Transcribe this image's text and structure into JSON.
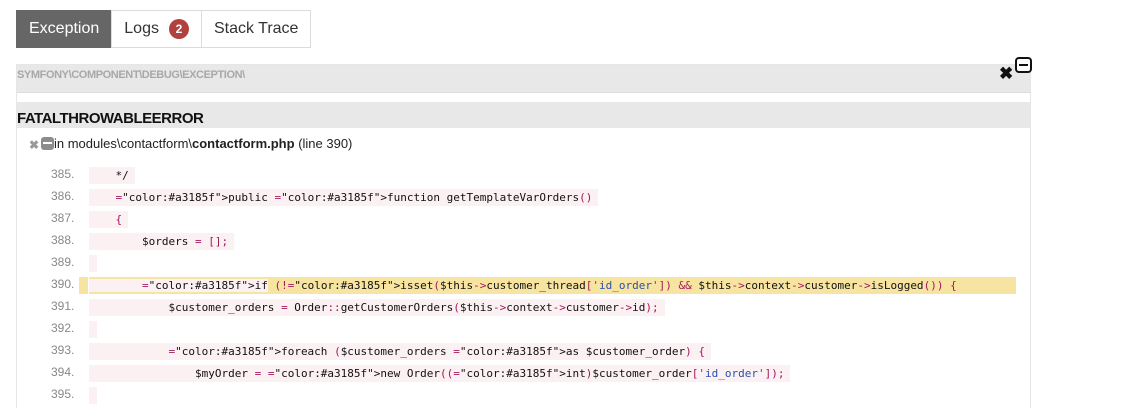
{
  "tabs": [
    {
      "label": "Exception",
      "active": true
    },
    {
      "label": "Logs",
      "badge": "2",
      "active": false
    },
    {
      "label": "Stack Trace",
      "active": false
    }
  ],
  "exception": {
    "namespace": "SYMFONY\\COMPONENT\\DEBUG\\EXCEPTION\\",
    "class": "FATALTHROWABLEERROR",
    "location_prefix": "in modules\\contactform\\",
    "file": "contactform.php",
    "line_info": " (line 390)"
  },
  "code_lines": [
    {
      "no": "385.",
      "code": "    */"
    },
    {
      "no": "386.",
      "code": "    public function getTemplateVarOrders()"
    },
    {
      "no": "387.",
      "code": "    {"
    },
    {
      "no": "388.",
      "code": "        $orders = [];"
    },
    {
      "no": "389.",
      "code": ""
    },
    {
      "no": "390.",
      "code": "        if (!isset($this->customer_thread['id_order']) && $this->context->customer->isLogged()) {",
      "highlight": true
    },
    {
      "no": "391.",
      "code": "            $customer_orders = Order::getCustomerOrders($this->context->customer->id);"
    },
    {
      "no": "392.",
      "code": ""
    },
    {
      "no": "393.",
      "code": "            foreach ($customer_orders as $customer_order) {"
    },
    {
      "no": "394.",
      "code": "                $myOrder = new Order((int)$customer_order['id_order']);"
    },
    {
      "no": "395.",
      "code": ""
    }
  ],
  "colors": {
    "keyword": "#a3185f",
    "string": "#2b52a8",
    "variable": "#111111",
    "highlight": "#f7e4a1"
  }
}
